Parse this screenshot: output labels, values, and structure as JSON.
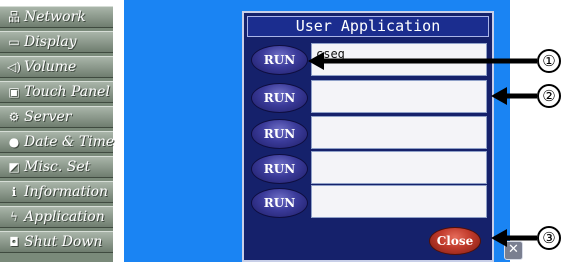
{
  "sidebar": {
    "items": [
      {
        "label": "Network",
        "icon": "network-icon",
        "glyph": "品"
      },
      {
        "label": "Display",
        "icon": "display-icon",
        "glyph": "▭"
      },
      {
        "label": "Volume",
        "icon": "volume-icon",
        "glyph": "◁)"
      },
      {
        "label": "Touch Panel",
        "icon": "touch-panel-icon",
        "glyph": "▣"
      },
      {
        "label": "Server",
        "icon": "server-icon",
        "glyph": "⚙"
      },
      {
        "label": "Date & Time",
        "icon": "clock-icon",
        "glyph": "●"
      },
      {
        "label": "Misc. Set",
        "icon": "misc-icon",
        "glyph": "◩"
      },
      {
        "label": "Information",
        "icon": "information-icon",
        "glyph": "ℹ"
      },
      {
        "label": "Application",
        "icon": "lightning-icon",
        "glyph": "ϟ"
      },
      {
        "label": "Shut Down",
        "icon": "shutdown-icon",
        "glyph": "◘"
      }
    ]
  },
  "dialog": {
    "title": "User Application",
    "run_label": "RUN",
    "rows": [
      {
        "value": "cseg"
      },
      {
        "value": ""
      },
      {
        "value": ""
      },
      {
        "value": ""
      },
      {
        "value": ""
      }
    ],
    "close_label": "Close",
    "x_label": "✕"
  },
  "callouts": [
    "①",
    "②",
    "③"
  ],
  "colors": {
    "desktop": "#1a84f3",
    "dialog_bg": "#15216b",
    "run_button": "#3b3b9a",
    "close_button": "#c03a2b"
  }
}
